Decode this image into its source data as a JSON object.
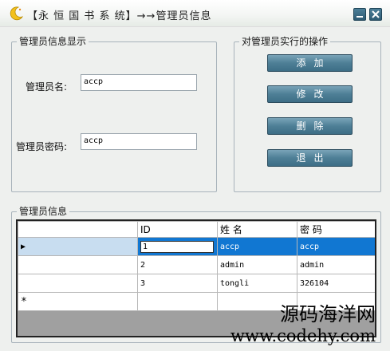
{
  "window": {
    "title": "【永 恒 国 书 系 统】→→管理员信息",
    "minimize_icon": "minimize-icon",
    "close_icon": "close-icon"
  },
  "info_group": {
    "legend": "管理员信息显示",
    "name_label": "管理员名:",
    "name_value": "accp",
    "password_label": "管理员密码:",
    "password_value": "accp"
  },
  "actions_group": {
    "legend": "对管理员实行的操作",
    "add": "添加",
    "edit": "修改",
    "delete": "删除",
    "exit": "退出"
  },
  "grid_group": {
    "legend": "管理员信息",
    "columns": [
      "ID",
      "姓 名",
      "密 码"
    ],
    "rows": [
      {
        "id": "1",
        "name": "accp",
        "password": "accp"
      },
      {
        "id": "2",
        "name": "admin",
        "password": "admin"
      },
      {
        "id": "3",
        "name": "tongli",
        "password": "326104"
      }
    ],
    "current_row_marker": "▶",
    "new_row_marker": "*"
  },
  "watermark": {
    "line1": "源码海洋网",
    "line2": "www.codehy.com"
  },
  "colors": {
    "button": "#4e7f96",
    "selected_row": "#1177d2"
  }
}
